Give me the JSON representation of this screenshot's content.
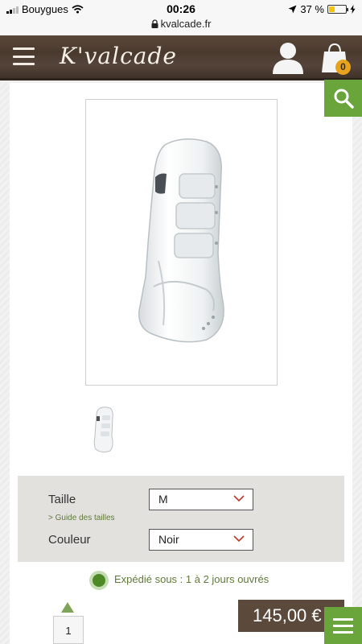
{
  "status_bar": {
    "carrier": "Bouygues",
    "time": "00:26",
    "url": "kvalcade.fr",
    "battery": "37 %",
    "battery_level": 0.37
  },
  "header": {
    "logo": "K'valcade",
    "cart_count": "0"
  },
  "options": {
    "size_label": "Taille",
    "size_value": "M",
    "size_guide": "> Guide des tailles",
    "color_label": "Couleur",
    "color_value": "Noir"
  },
  "shipping": {
    "text": "Expédié sous : 1 à 2 jours ouvrés"
  },
  "purchase": {
    "quantity": "1",
    "price": "145,00 €"
  },
  "colors": {
    "brand_brown": "#5b4a3c",
    "accent_green": "#6aa53c",
    "cart_badge": "#e8a31c"
  },
  "icons": [
    "signal-icon",
    "wifi-icon",
    "lock-icon",
    "location-icon",
    "battery-icon",
    "charging-icon",
    "hamburger-menu-icon",
    "user-icon",
    "shopping-bag-icon",
    "search-icon",
    "chevron-down-icon",
    "availability-dot-icon",
    "arrow-up-icon",
    "menu-icon"
  ]
}
